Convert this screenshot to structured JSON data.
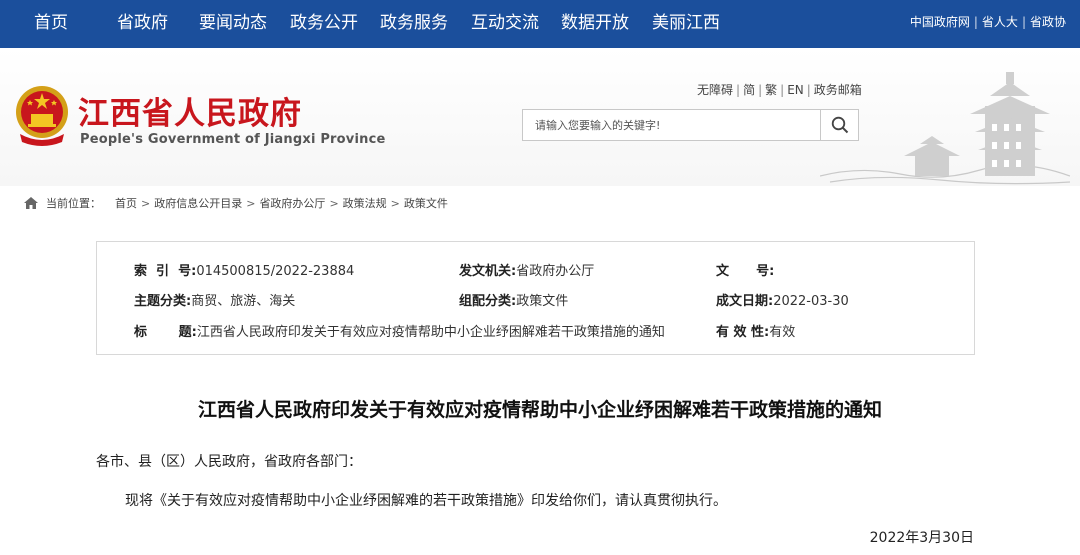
{
  "nav": {
    "items": [
      "首页",
      "省政府",
      "要闻动态",
      "政务公开",
      "政务服务",
      "互动交流",
      "数据开放",
      "美丽江西"
    ],
    "links": [
      "中国政府网",
      "省人大",
      "省政协"
    ]
  },
  "header": {
    "site_name_cn": "江西省人民政府",
    "site_name_en": "People's Government of Jiangxi Province",
    "util_links": [
      "无障碍",
      "简",
      "繁",
      "EN",
      "政务邮箱"
    ],
    "search": {
      "placeholder": "请输入您要输入的关键字!"
    },
    "colors": {
      "nav_bg": "#1b4f9c",
      "brand_red": "#c8161d"
    }
  },
  "breadcrumb": {
    "label": "当前位置：",
    "items": [
      "首页",
      "政府信息公开目录",
      "省政府办公厅",
      "政策法规",
      "政策文件"
    ]
  },
  "info": {
    "index_key": "索  引  号:",
    "index_val": "014500815/2022-23884",
    "issuer_key": "发文机关:",
    "issuer_val": "省政府办公厅",
    "docno_key": "文      号:",
    "docno_val": "",
    "topic_key": "主题分类:",
    "topic_val": "商贸、旅游、海关",
    "group_key": "组配分类:",
    "group_val": "政策文件",
    "date_key": "成文日期:",
    "date_val": "2022-03-30",
    "title_key": "标       题:",
    "title_val": "江西省人民政府印发关于有效应对疫情帮助中小企业纾困解难若干政策措施的通知",
    "valid_key": "有 效 性:",
    "valid_val": "有效"
  },
  "article": {
    "title": "江西省人民政府印发关于有效应对疫情帮助中小企业纾困解难若干政策措施的通知",
    "salutation": "各市、县（区）人民政府，省政府各部门：",
    "body": "现将《关于有效应对疫情帮助中小企业纾困解难的若干政策措施》印发给你们，请认真贯彻执行。",
    "date": "2022年3月30日"
  }
}
